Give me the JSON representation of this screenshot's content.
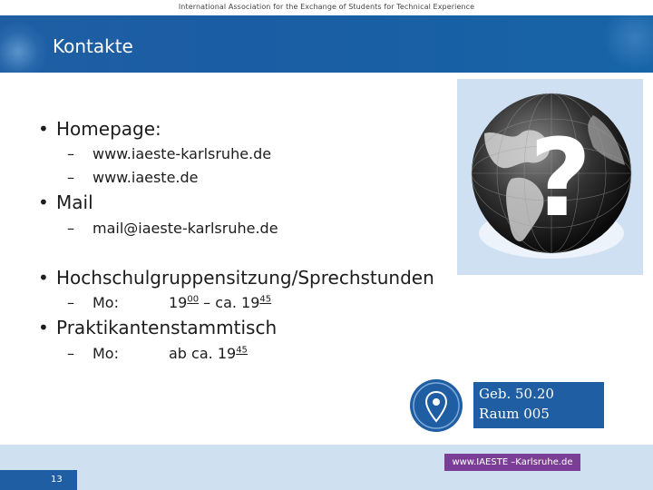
{
  "header": {
    "caption": "International Association for the Exchange of Students for Technical Experience",
    "title": "Kontakte"
  },
  "bullets": {
    "homepage": "Homepage:",
    "homepage_links": [
      "www.iaeste-karlsruhe.de",
      "www.iaeste.de"
    ],
    "mail": "Mail",
    "mail_address": "mail@iaeste-karlsruhe.de",
    "meeting": "Hochschulgruppensitzung/Sprechstunden",
    "meeting_day": "Mo:",
    "meeting_time_start": "19",
    "meeting_time_start_sup": "00",
    "meeting_time_sep": " – ca. 19",
    "meeting_time_end_sup": "45",
    "stammtisch": "Praktikantenstammtisch",
    "stammtisch_day": "Mo:",
    "stammtisch_time": "ab ca. 19",
    "stammtisch_time_sup": "45",
    "bullet_char": "•",
    "dash_char": "–"
  },
  "location": {
    "line1": "Geb. 50.20",
    "line2": "Raum 005",
    "icon": "map-pin-icon"
  },
  "image": {
    "icon": "globe-question-icon",
    "question_mark": "?"
  },
  "footer": {
    "link": "www.IAESTE –Karlsruhe.de",
    "page_number": "13"
  },
  "colors": {
    "header_blue": "#1f5ea3",
    "footer_band": "#cfe1f1",
    "link_purple": "#7a3e97"
  }
}
